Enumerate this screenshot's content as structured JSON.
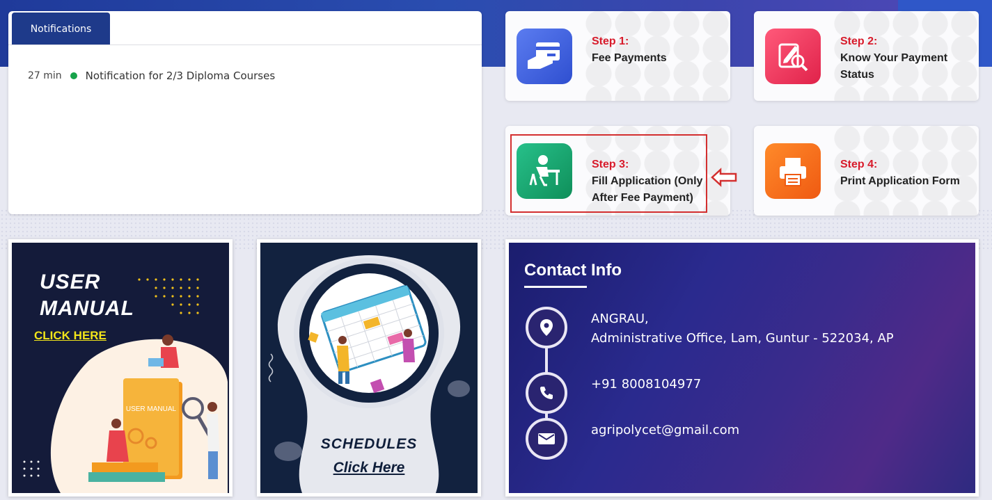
{
  "notifications": {
    "tab_label": "Notifications",
    "items": [
      {
        "time": "27 min",
        "text": "Notification for 2/3 Diploma Courses"
      }
    ]
  },
  "steps": [
    {
      "step": "Step 1:",
      "label": "Fee Payments",
      "icon": "card-payment-icon",
      "color": "#3b5bdb"
    },
    {
      "step": "Step 2:",
      "label": "Know Your Payment Status",
      "icon": "search-edit-icon",
      "color": "#e8315a"
    },
    {
      "step": "Step 3:",
      "label": "Fill Application (Only After Fee Payment)",
      "icon": "student-desk-icon",
      "color": "#16a36b"
    },
    {
      "step": "Step 4:",
      "label": "Print Application Form",
      "icon": "printer-icon",
      "color": "#f06a1a"
    }
  ],
  "user_manual": {
    "title_line1": "USER",
    "title_line2": "MANUAL",
    "link": "CLICK HERE",
    "book_label": "USER MANUAL"
  },
  "schedules": {
    "title": "SCHEDULES",
    "link": "Click Here"
  },
  "contact": {
    "title": "Contact Info",
    "address_line1": "ANGRAU,",
    "address_line2": "Administrative Office, Lam, Guntur - 522034, AP",
    "phone": "+91 8008104977",
    "email": "agripolycet@gmail.com"
  }
}
